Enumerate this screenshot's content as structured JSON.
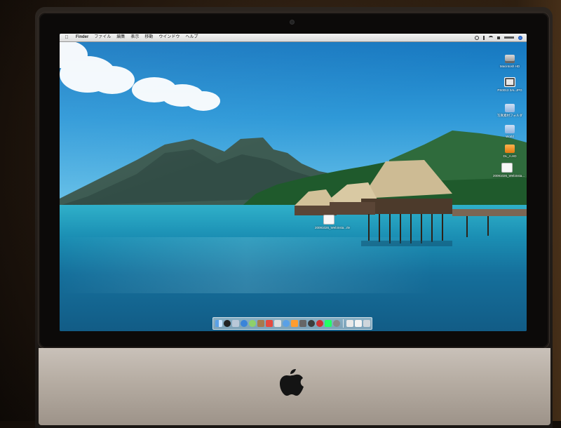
{
  "menubar": {
    "apple_icon": "apple-icon",
    "items": [
      "Finder",
      "ファイル",
      "編集",
      "表示",
      "移動",
      "ウインドウ",
      "ヘルプ"
    ],
    "status_icons": [
      "time-machine-icon",
      "bluetooth-icon",
      "wifi-icon",
      "volume-icon",
      "clock-icon",
      "spotlight-icon"
    ]
  },
  "desktop_icons": [
    {
      "label": "Macintosh HD",
      "icon": "hard-drive-icon"
    },
    {
      "label": "PS0013 3AL.JPG",
      "icon": "image-file-icon"
    },
    {
      "label": "写真素材フォルダ",
      "icon": "folder-icon"
    },
    {
      "label": "World",
      "icon": "folder-icon"
    },
    {
      "label": "DL_A.HD",
      "icon": "app-icon"
    },
    {
      "label": "20091026_Webinsta...",
      "icon": "document-icon"
    },
    {
      "label": "20091026_Webinsta...rle",
      "icon": "document-icon"
    }
  ],
  "dock": {
    "apps": [
      "finder-icon",
      "dashboard-icon",
      "mail-icon",
      "safari-icon",
      "ichat-icon",
      "address-book-icon",
      "ical-icon",
      "preview-icon",
      "itunes-icon",
      "iphoto-icon",
      "imovie-icon",
      "garageband-icon",
      "photo-booth-icon",
      "time-machine-icon",
      "system-preferences-icon"
    ],
    "right": [
      "downloads-stack-icon",
      "documents-stack-icon",
      "trash-icon"
    ]
  },
  "colors": {
    "menubar": "#e6e6e6",
    "sky": "#2f99d8",
    "sea": "#156f9b",
    "bezel": "#0c0a09",
    "chin": "#b7aea4"
  },
  "hardware": {
    "logo": "apple-logo-icon"
  }
}
